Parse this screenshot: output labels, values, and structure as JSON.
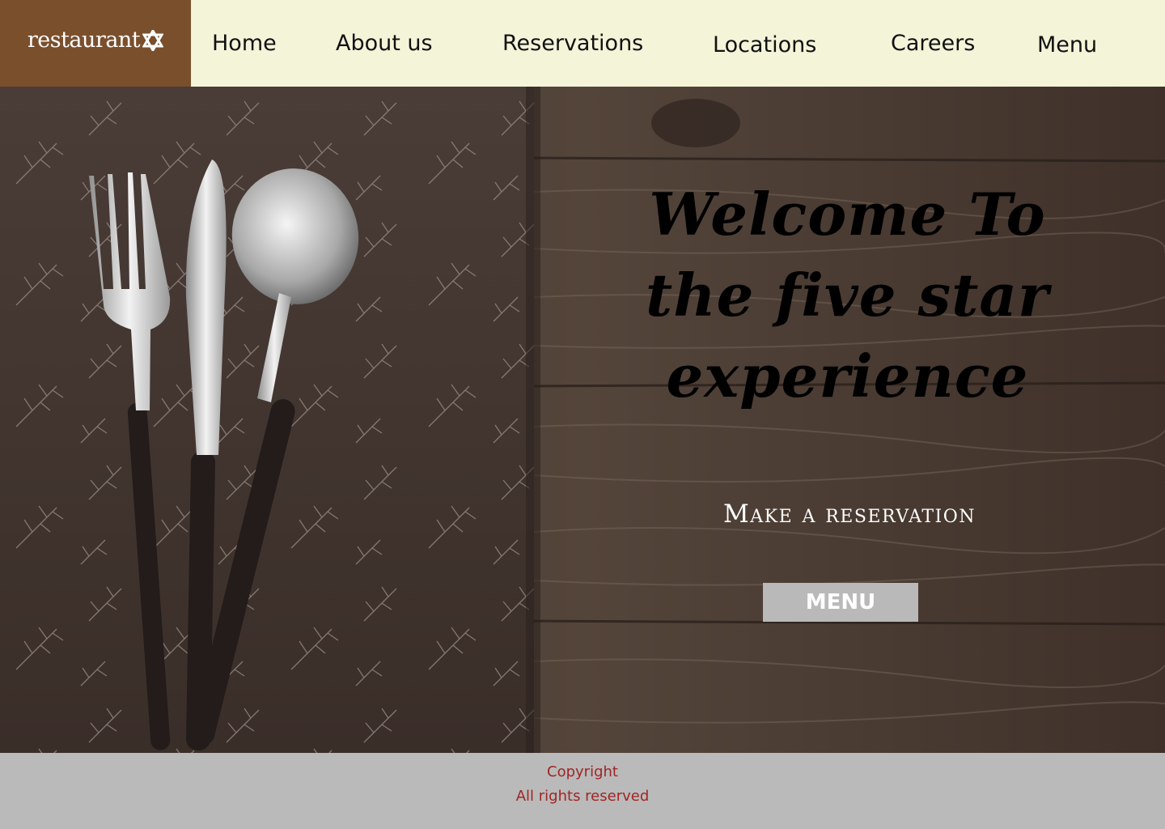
{
  "header": {
    "logo_text": "restaurant",
    "logo_icon": "star-of-david-icon",
    "nav": [
      {
        "label": "Home"
      },
      {
        "label": "About us"
      },
      {
        "label": "Reservations"
      },
      {
        "label": "Locations"
      },
      {
        "label": "Careers"
      },
      {
        "label": "Menu"
      }
    ]
  },
  "hero": {
    "title": "Welcome To the five star experience",
    "reservation_link": "Make a reservation",
    "menu_button": "MENU"
  },
  "footer": {
    "copyright": "Copyright",
    "rights": "All rights reserved"
  },
  "colors": {
    "nav_background": "#f4f4d9",
    "logo_background": "#7a4f2c",
    "footer_background": "#bababa",
    "footer_text": "#a02525",
    "menu_button": "#b9b9b9"
  }
}
